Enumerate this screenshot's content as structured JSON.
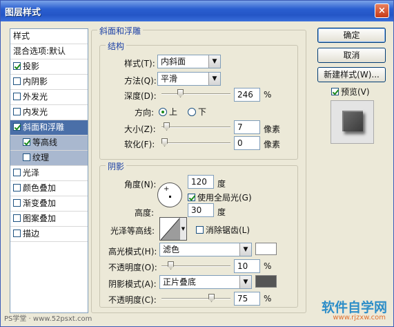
{
  "window": {
    "title": "图层样式",
    "close_glyph": "×"
  },
  "sidebar": {
    "header": "样式",
    "items": [
      {
        "label": "混合选项:默认",
        "check": null,
        "selected": false,
        "sub": false
      },
      {
        "label": "投影",
        "check": true,
        "selected": false,
        "sub": false
      },
      {
        "label": "内阴影",
        "check": false,
        "selected": false,
        "sub": false
      },
      {
        "label": "外发光",
        "check": false,
        "selected": false,
        "sub": false
      },
      {
        "label": "内发光",
        "check": false,
        "selected": false,
        "sub": false
      },
      {
        "label": "斜面和浮雕",
        "check": true,
        "selected": true,
        "sub": false
      },
      {
        "label": "等高线",
        "check": true,
        "selected": false,
        "sub": true
      },
      {
        "label": "纹理",
        "check": false,
        "selected": false,
        "sub": true
      },
      {
        "label": "光泽",
        "check": false,
        "selected": false,
        "sub": false
      },
      {
        "label": "颜色叠加",
        "check": false,
        "selected": false,
        "sub": false
      },
      {
        "label": "渐变叠加",
        "check": false,
        "selected": false,
        "sub": false
      },
      {
        "label": "图案叠加",
        "check": false,
        "selected": false,
        "sub": false
      },
      {
        "label": "描边",
        "check": false,
        "selected": false,
        "sub": false
      }
    ]
  },
  "bevel": {
    "title": "斜面和浮雕",
    "structure": {
      "title": "结构",
      "style_label": "样式(T):",
      "style_value": "内斜面",
      "technique_label": "方法(Q):",
      "technique_value": "平滑",
      "depth_label": "深度(D):",
      "depth_value": "246",
      "depth_unit": "%",
      "depth_fraction": 0.25,
      "direction_label": "方向:",
      "direction_up": "上",
      "direction_down": "下",
      "direction_selected": "up",
      "size_label": "大小(Z):",
      "size_value": "7",
      "size_unit": "像素",
      "size_fraction": 0.03,
      "soften_label": "软化(F):",
      "soften_value": "0",
      "soften_unit": "像素",
      "soften_fraction": 0.0
    },
    "shading": {
      "title": "阴影",
      "angle_label": "角度(N):",
      "angle_value": "120",
      "angle_unit": "度",
      "global_light_label": "使用全局光(G)",
      "global_light_checked": true,
      "altitude_label": "高度:",
      "altitude_value": "30",
      "altitude_unit": "度",
      "gloss_contour_label": "光泽等高线:",
      "anti_aliased_label": "消除锯齿(L)",
      "anti_aliased_checked": false,
      "highlight_mode_label": "高光模式(H):",
      "highlight_mode_value": "滤色",
      "highlight_color": "#ffffff",
      "highlight_opacity_label": "不透明度(O):",
      "highlight_opacity_value": "10",
      "highlight_opacity_unit": "%",
      "highlight_opacity_fraction": 0.1,
      "shadow_mode_label": "阴影模式(A):",
      "shadow_mode_value": "正片叠底",
      "shadow_color": "#555555",
      "shadow_opacity_label": "不透明度(C):",
      "shadow_opacity_value": "75",
      "shadow_opacity_unit": "%",
      "shadow_opacity_fraction": 0.75
    }
  },
  "buttons": {
    "ok": "确定",
    "cancel": "取消",
    "new_style": "新建样式(W)...",
    "preview_label": "预览(V)",
    "preview_checked": true
  },
  "watermarks": {
    "left": "PS学堂 · www.52psxt.com",
    "right_main": "软件自学网",
    "right_sub": "www.rjzxw.com"
  },
  "colors": {
    "titlebar": "#2456c6",
    "selected_row": "#4a6fa8",
    "accent_text": "#1a3fa5"
  }
}
